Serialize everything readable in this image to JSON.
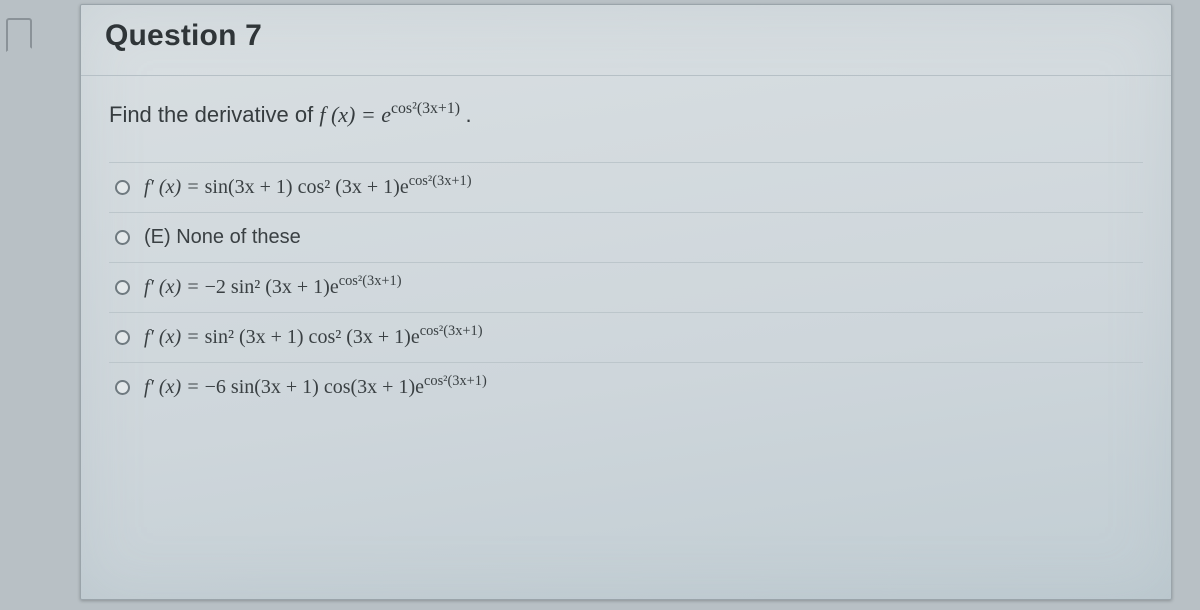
{
  "header": {
    "title": "Question 7"
  },
  "prompt": {
    "lead": "Find the derivative of ",
    "func_lhs": "f (x) = e",
    "func_exp": "cos²(3x+1)",
    "trail": "."
  },
  "options": [
    {
      "lhs": "f′ (x) = ",
      "body": "sin(3x + 1) cos² (3x + 1)e",
      "exp": "cos²(3x+1)"
    },
    {
      "lhs": "",
      "body": "(E) None of these",
      "exp": ""
    },
    {
      "lhs": "f′ (x) = ",
      "body": "−2 sin² (3x + 1)e",
      "exp": "cos²(3x+1)"
    },
    {
      "lhs": "f′ (x) = ",
      "body": "sin² (3x + 1) cos² (3x + 1)e",
      "exp": "cos²(3x+1)"
    },
    {
      "lhs": "f′ (x) = ",
      "body": "−6 sin(3x + 1) cos(3x + 1)e",
      "exp": "cos²(3x+1)"
    }
  ]
}
